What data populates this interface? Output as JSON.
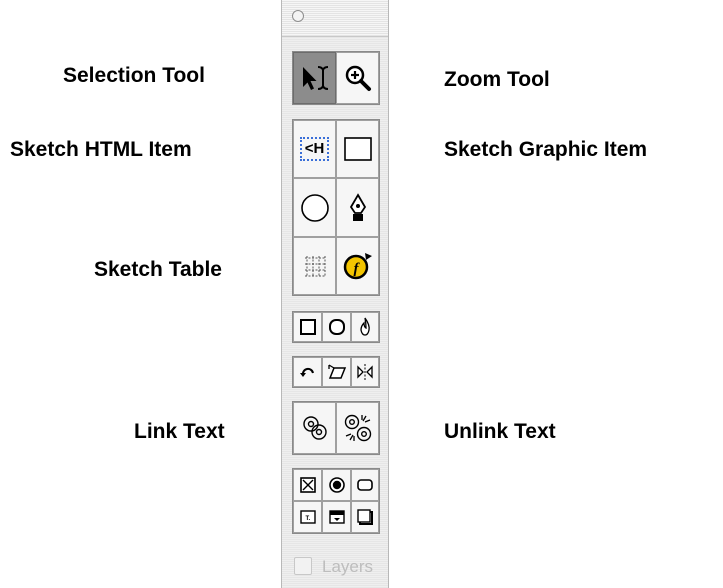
{
  "labels": {
    "selection_tool": "Selection Tool",
    "zoom_tool": "Zoom Tool",
    "sketch_html_item": "Sketch HTML Item",
    "sketch_graphic_item": "Sketch Graphic Item",
    "sketch_table": "Sketch Table",
    "link_text": "Link Text",
    "unlink_text": "Unlink Text"
  },
  "palette": {
    "html_item_glyph": "<H",
    "layers_label": "Layers"
  },
  "colors": {
    "selected_button": "#8c8c8c",
    "html_item_border": "#3a6fd8",
    "layers_text": "#bdbdbd"
  },
  "icons": [
    "selection-arrow-icon",
    "text-cursor-icon",
    "zoom-in-icon",
    "html-item-icon",
    "rectangle-icon",
    "circle-icon",
    "pen-icon",
    "table-grid-icon",
    "flash-object-icon",
    "rectangle-shape-icon",
    "ellipse-shape-icon",
    "flame-icon",
    "rotate-icon",
    "skew-icon",
    "flip-icon",
    "link-icon",
    "unlink-icon",
    "checkbox-icon",
    "radio-icon",
    "button-icon",
    "text-field-icon",
    "popup-menu-icon",
    "listbox-icon"
  ]
}
